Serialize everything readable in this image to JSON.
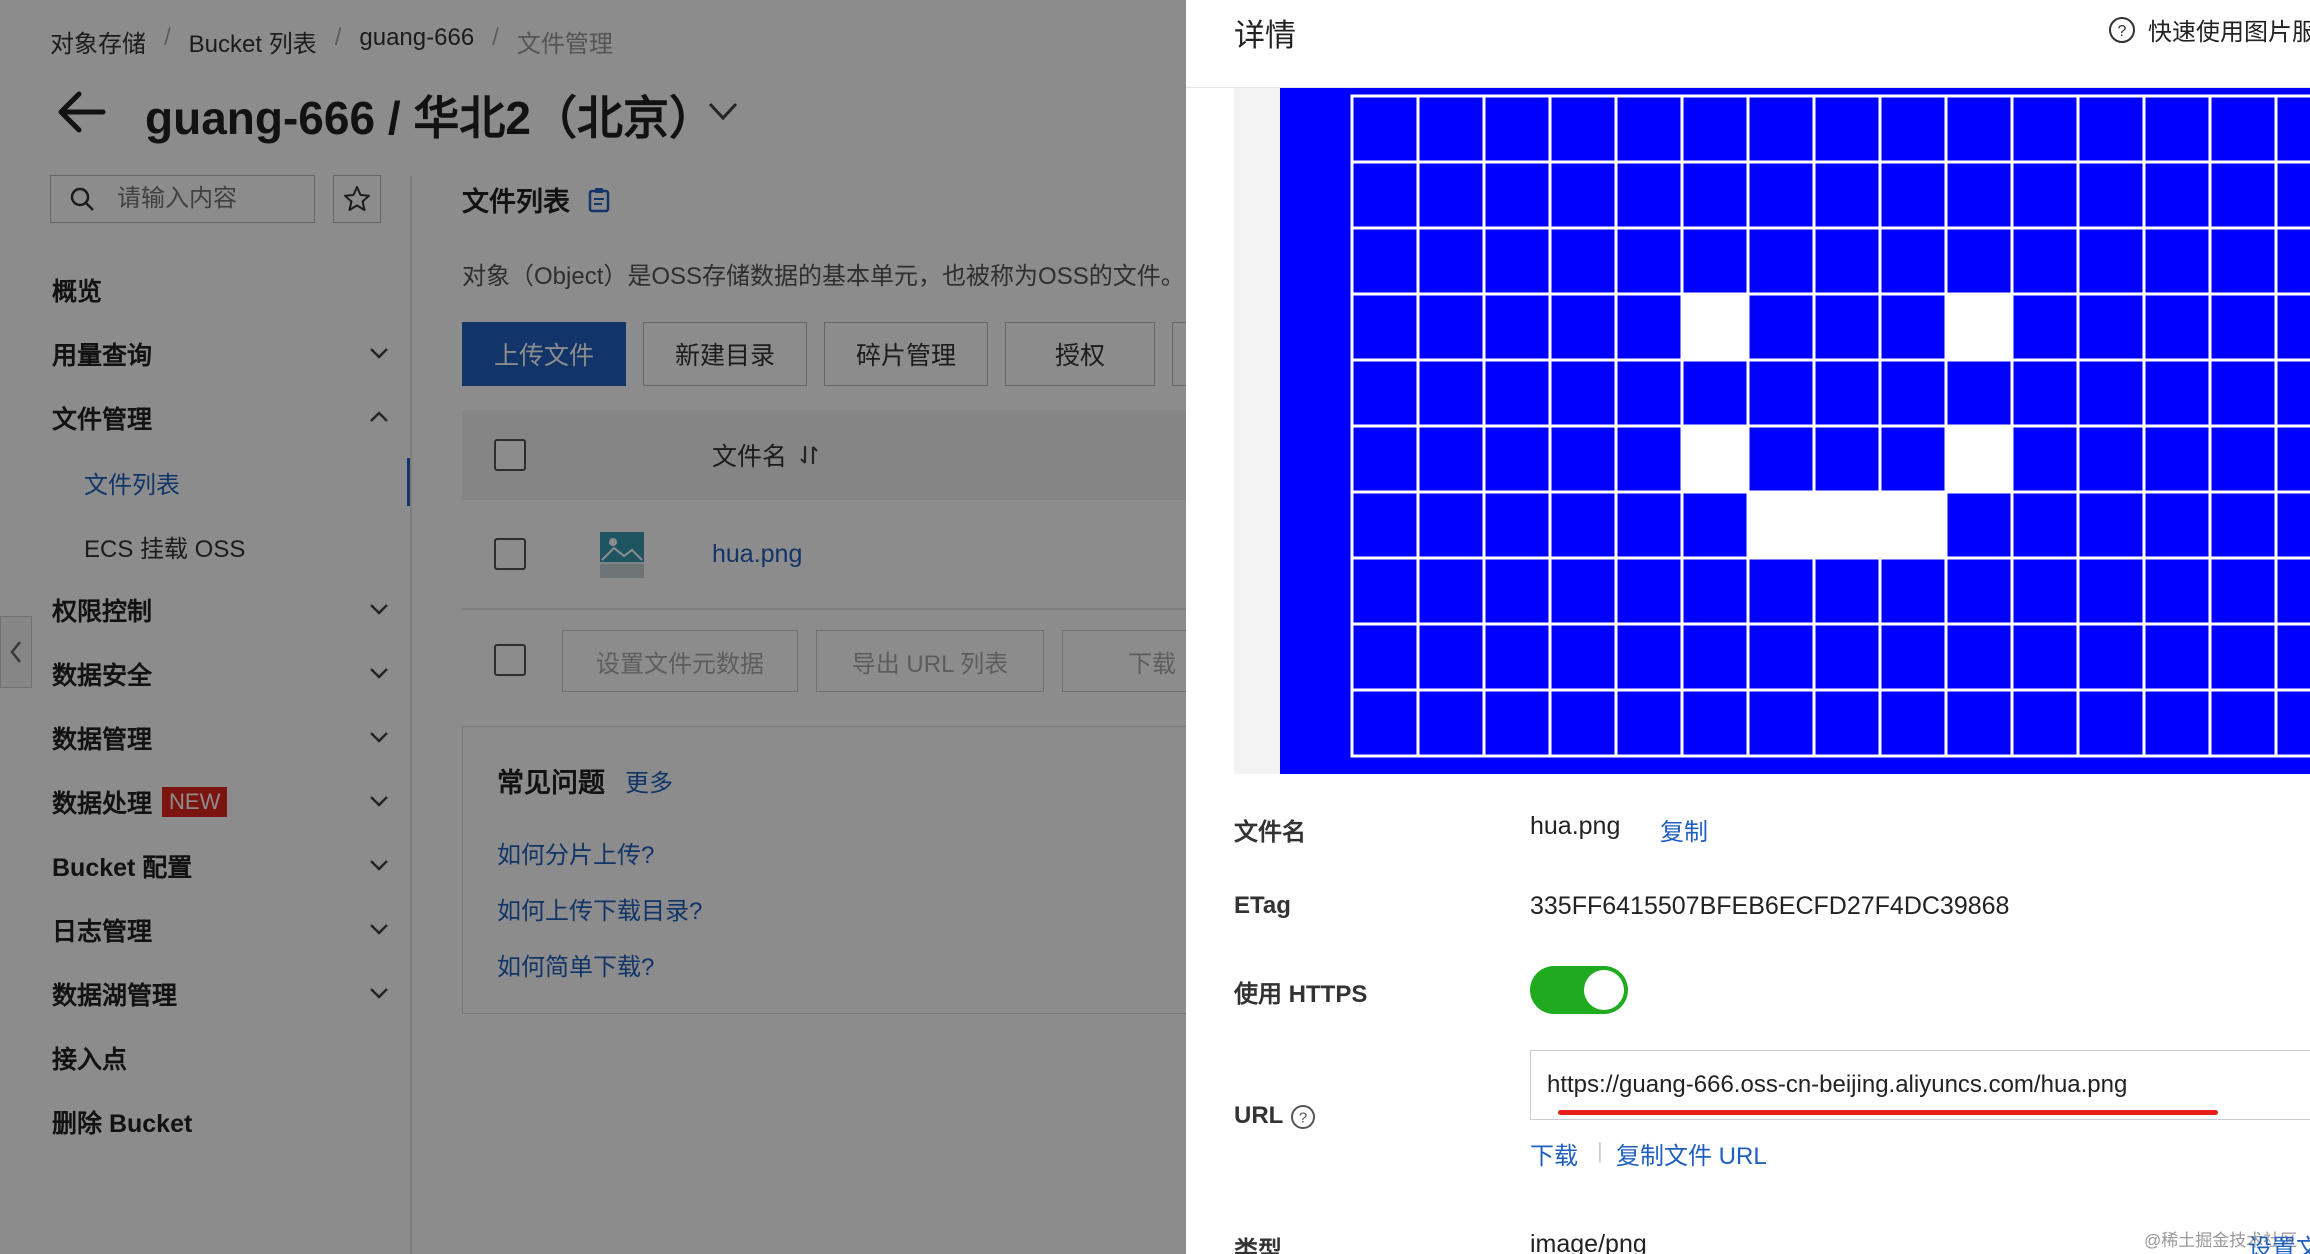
{
  "breadcrumb": [
    "对象存储",
    "Bucket 列表",
    "guang-666",
    "文件管理"
  ],
  "page_title": "guang-666 / 华北2（北京）",
  "search": {
    "placeholder": "请输入内容"
  },
  "nav": {
    "items": [
      {
        "label": "概览",
        "chevron": false
      },
      {
        "label": "用量查询",
        "chevron": "down"
      },
      {
        "label": "文件管理",
        "chevron": "up"
      },
      {
        "label": "文件列表",
        "sub": true,
        "active": true
      },
      {
        "label": "ECS 挂载 OSS",
        "sub": true
      },
      {
        "label": "权限控制",
        "chevron": "down"
      },
      {
        "label": "数据安全",
        "chevron": "down"
      },
      {
        "label": "数据管理",
        "chevron": "down"
      },
      {
        "label": "数据处理",
        "chevron": "down",
        "badge": "NEW"
      },
      {
        "label": "Bucket 配置",
        "chevron": "down"
      },
      {
        "label": "日志管理",
        "chevron": "down"
      },
      {
        "label": "数据湖管理",
        "chevron": "down"
      },
      {
        "label": "接入点",
        "chevron": false
      },
      {
        "label": "删除 Bucket",
        "chevron": false
      }
    ]
  },
  "file_list": {
    "title": "文件列表",
    "description": "对象（Object）是OSS存储数据的基本单元，也被称为OSS的文件。",
    "toolbar": [
      "上传文件",
      "新建目录",
      "碎片管理",
      "授权"
    ],
    "column_name": "文件名",
    "rows": [
      {
        "name": "hua.png"
      }
    ],
    "bulk_actions": [
      "设置文件元数据",
      "导出 URL 列表",
      "下载"
    ]
  },
  "faq": {
    "title": "常见问题",
    "more": "更多",
    "links": [
      "如何分片上传?",
      "如何上传下载目录?",
      "如何简单下载?"
    ]
  },
  "drawer": {
    "title": "详情",
    "help": "快速使用图片服",
    "filename_label": "文件名",
    "filename_value": "hua.png",
    "copy_label": "复制",
    "etag_label": "ETag",
    "etag_value": "335FF6415507BFEB6ECFD27F4DC39868",
    "https_label": "使用 HTTPS",
    "https_enabled": true,
    "url_label": "URL",
    "url_value": "https://guang-666.oss-cn-beijing.aliyuncs.com/hua.png",
    "download_label": "下载",
    "copy_url_label": "复制文件 URL",
    "type_label": "类型",
    "type_value": "image/png",
    "set_link": "设置文",
    "watermark": "@稀土掘金技术社区"
  },
  "preview": {
    "colors": {
      "fill": "#0000ff",
      "grid": "#ffffff"
    },
    "white_cells": [
      [
        3,
        5
      ],
      [
        3,
        9
      ],
      [
        5,
        5
      ],
      [
        5,
        9
      ],
      [
        6,
        6
      ],
      [
        6,
        7
      ],
      [
        6,
        8
      ]
    ]
  },
  "colors": {
    "accent": "#1f5fbf",
    "toggle_on": "#1fab1f",
    "badge": "#e0261b",
    "annotation": "#e8201a"
  }
}
